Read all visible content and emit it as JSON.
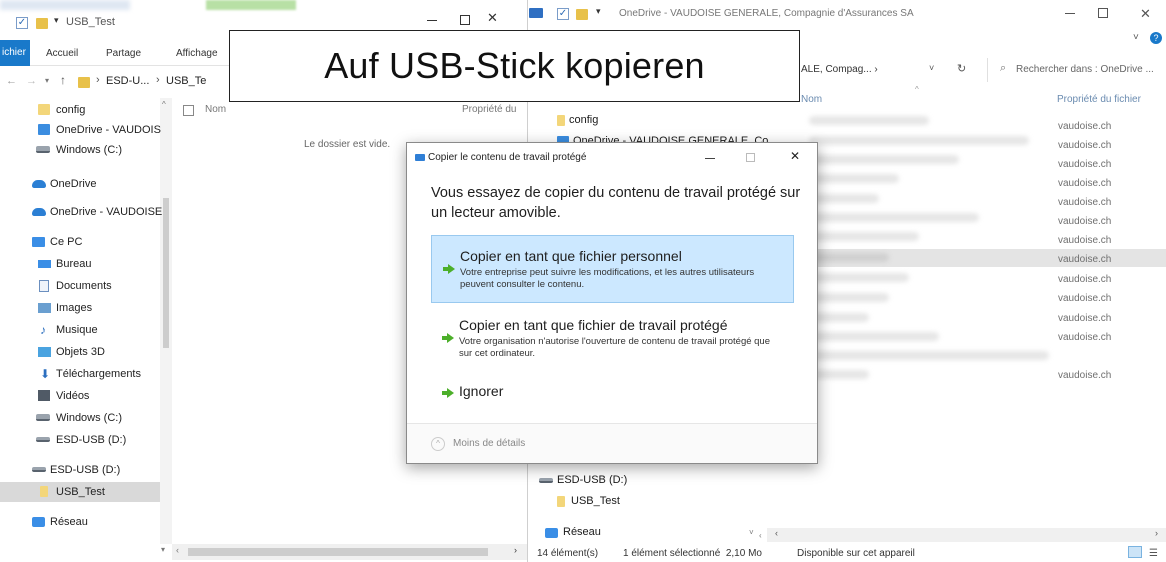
{
  "left_window": {
    "title": "USB_Test",
    "ribbon_tabs": [
      "ichier",
      "Accueil",
      "Partage",
      "Affichage"
    ],
    "breadcrumb": [
      "ESD-U...",
      "USB_Te"
    ],
    "column_name": "Nom",
    "column_prop": "Propriété du",
    "empty_text": "Le dossier est vide.",
    "nav": [
      {
        "label": "config",
        "icon": "folder-icon"
      },
      {
        "label": "OneDrive - VAUDOIS",
        "icon": "onedrive-folder-icon"
      },
      {
        "label": "Windows (C:)",
        "icon": "drive-icon"
      },
      {
        "label": "OneDrive",
        "icon": "cloud-icon"
      },
      {
        "label": "OneDrive - VAUDOISE",
        "icon": "cloud-icon"
      },
      {
        "label": "Ce PC",
        "icon": "pc-icon"
      },
      {
        "label": "Bureau",
        "icon": "desktop-icon"
      },
      {
        "label": "Documents",
        "icon": "documents-icon"
      },
      {
        "label": "Images",
        "icon": "images-icon"
      },
      {
        "label": "Musique",
        "icon": "music-icon"
      },
      {
        "label": "Objets 3D",
        "icon": "objects3d-icon"
      },
      {
        "label": "Téléchargements",
        "icon": "download-icon"
      },
      {
        "label": "Vidéos",
        "icon": "videos-icon"
      },
      {
        "label": "Windows (C:)",
        "icon": "drive-icon"
      },
      {
        "label": "ESD-USB (D:)",
        "icon": "usb-drive-icon"
      },
      {
        "label": "ESD-USB (D:)",
        "icon": "usb-drive-icon"
      },
      {
        "label": "USB_Test",
        "icon": "folder-icon"
      },
      {
        "label": "Réseau",
        "icon": "network-icon"
      }
    ]
  },
  "right_window": {
    "title": "OneDrive - VAUDOISE GENERALE, Compagnie d'Assurances SA",
    "breadcrumb": "ALE, Compag... ›",
    "search_placeholder": "Rechercher dans : OneDrive ...",
    "column_name": "Nom",
    "column_prop": "Propriété du fichier",
    "nav": [
      {
        "label": "config"
      },
      {
        "label": "OneDrive - VAUDOISE GENERALE, Co"
      },
      {
        "label": "ESD-USB (D:)"
      },
      {
        "label": "USB_Test"
      },
      {
        "label": "Réseau"
      }
    ],
    "property_values": [
      "vaudoise.ch",
      "vaudoise.ch",
      "vaudoise.ch",
      "vaudoise.ch",
      "vaudoise.ch",
      "vaudoise.ch",
      "vaudoise.ch",
      "vaudoise.ch",
      "vaudoise.ch",
      "vaudoise.ch",
      "vaudoise.ch",
      "vaudoise.ch",
      "vaudoise.ch"
    ],
    "status": {
      "count": "14 élément(s)",
      "selected": "1 élément sélectionné  2,10 Mo",
      "availability": "Disponible sur cet appareil"
    }
  },
  "caption": "Auf USB-Stick kopieren",
  "dialog": {
    "title": "Copier le contenu de travail protégé",
    "heading": "Vous essayez de copier du contenu de travail protégé sur un lecteur amovible.",
    "options": [
      {
        "title": "Copier en tant que fichier personnel",
        "desc": "Votre entreprise peut suivre les modifications, et les autres utilisateurs peuvent consulter le contenu."
      },
      {
        "title": "Copier en tant que fichier de travail protégé",
        "desc": "Votre organisation n'autorise l'ouverture de contenu de travail protégé que sur cet ordinateur."
      },
      {
        "title": "Ignorer",
        "desc": ""
      }
    ],
    "details_label": "Moins de détails"
  },
  "colors": {
    "accent": "#0078d7",
    "selection": "#cce8ff",
    "green": "#4caf2a"
  }
}
